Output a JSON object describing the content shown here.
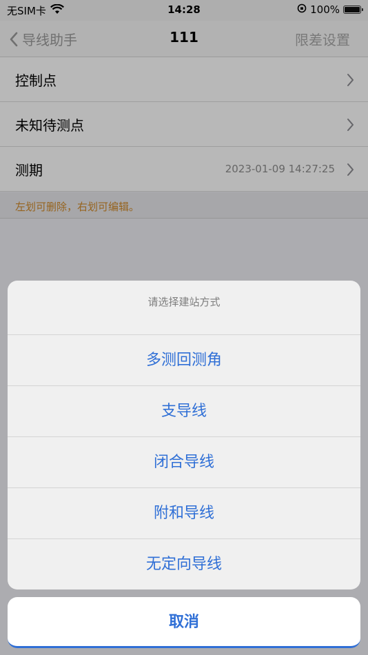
{
  "status_bar": {
    "carrier": "无SIM卡",
    "time": "14:28",
    "battery_pct": "100%"
  },
  "nav": {
    "back_label": "导线助手",
    "title": "111",
    "right_label": "限差设置"
  },
  "list": {
    "rows": [
      {
        "label": "控制点",
        "value": ""
      },
      {
        "label": "未知待测点",
        "value": ""
      },
      {
        "label": "测期",
        "value": "2023-01-09 14:27:25"
      }
    ],
    "hint": "左划可删除，右划可编辑。"
  },
  "action_sheet": {
    "title": "请选择建站方式",
    "options": [
      "多测回测角",
      "支导线",
      "闭合导线",
      "附和导线",
      "无定向导线"
    ],
    "cancel_label": "取消"
  },
  "colors": {
    "accent": "#2f6fd6",
    "hint_text": "#d08a2a"
  },
  "icons": {
    "back": "chevron-left-icon",
    "row_disclosure": "chevron-right-icon",
    "wifi": "wifi-icon",
    "orientation_lock": "orientation-lock-icon",
    "battery": "battery-icon"
  }
}
